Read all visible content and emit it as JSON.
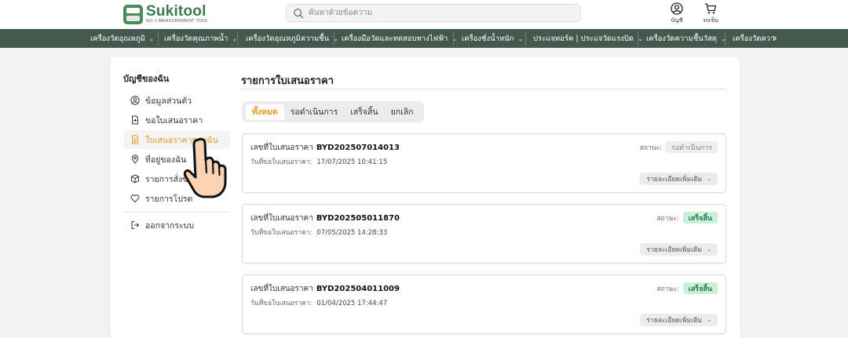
{
  "header": {
    "logo_name": "Sukitool",
    "logo_tagline": "NO.1 MEASUREMENT TOOL",
    "search_placeholder": "ค้นหาด้วยข้อความ",
    "account_label": "บัญชี",
    "cart_label": "รถเข็น",
    "brand_color": "#3c7a4e"
  },
  "nav": {
    "items": [
      "เครื่องวัดอุณหภูมิ",
      "เครื่องวัดคุณภาพน้ำ",
      "เครื่องวัดอุณหภูมิความชื้น",
      "เครื่องมือวัดและทดสอบทางไฟฟ้า",
      "เครื่องชั่งน้ำหนัก",
      "ประแจทอร์ค | ประแจวัดแรงบิด",
      "เครื่องวัดความชื้นวัสดุ",
      "เครื่องวัดควา"
    ],
    "background": "#44584f"
  },
  "sidebar": {
    "title": "บัญชีของฉัน",
    "items": [
      {
        "label": "ข้อมูลส่วนตัว",
        "icon": "user-circle-icon"
      },
      {
        "label": "ขอใบเสนอราคา",
        "icon": "document-request-icon"
      },
      {
        "label": "ใบเสนอราคาของฉัน",
        "icon": "document-icon",
        "active": true
      },
      {
        "label": "ที่อยู่ของฉัน",
        "icon": "map-pin-icon"
      },
      {
        "label": "รายการสั่งซื้อ",
        "icon": "box-icon"
      },
      {
        "label": "รายการโปรด",
        "icon": "heart-icon"
      }
    ],
    "logout_label": "ออกจากระบบ",
    "accent": "#e59a1d"
  },
  "main": {
    "title": "รายการใบเสนอราคา",
    "tabs": [
      {
        "label": "ทั้งหมด",
        "active": true
      },
      {
        "label": "รอดำเนินการ"
      },
      {
        "label": "เสร็จสิ้น"
      },
      {
        "label": "ยกเลิก"
      }
    ],
    "quote_label": "เลขที่ใบเสนอราคา",
    "date_label": "วันที่ขอใบเสนอราคา:",
    "status_label": "สถานะ:",
    "more_label": "รายละเอียดเพิ่มเติม",
    "quotes": [
      {
        "number": "BYD202507014013",
        "date": "17/07/2025 10:41:15",
        "status": "รอดำเนินการ",
        "status_type": "pending"
      },
      {
        "number": "BYD202505011870",
        "date": "07/05/2025 14:28:33",
        "status": "เสร็จสิ้น",
        "status_type": "done"
      },
      {
        "number": "BYD202504011009",
        "date": "01/04/2025 17:44:47",
        "status": "เสร็จสิ้น",
        "status_type": "done"
      }
    ]
  }
}
